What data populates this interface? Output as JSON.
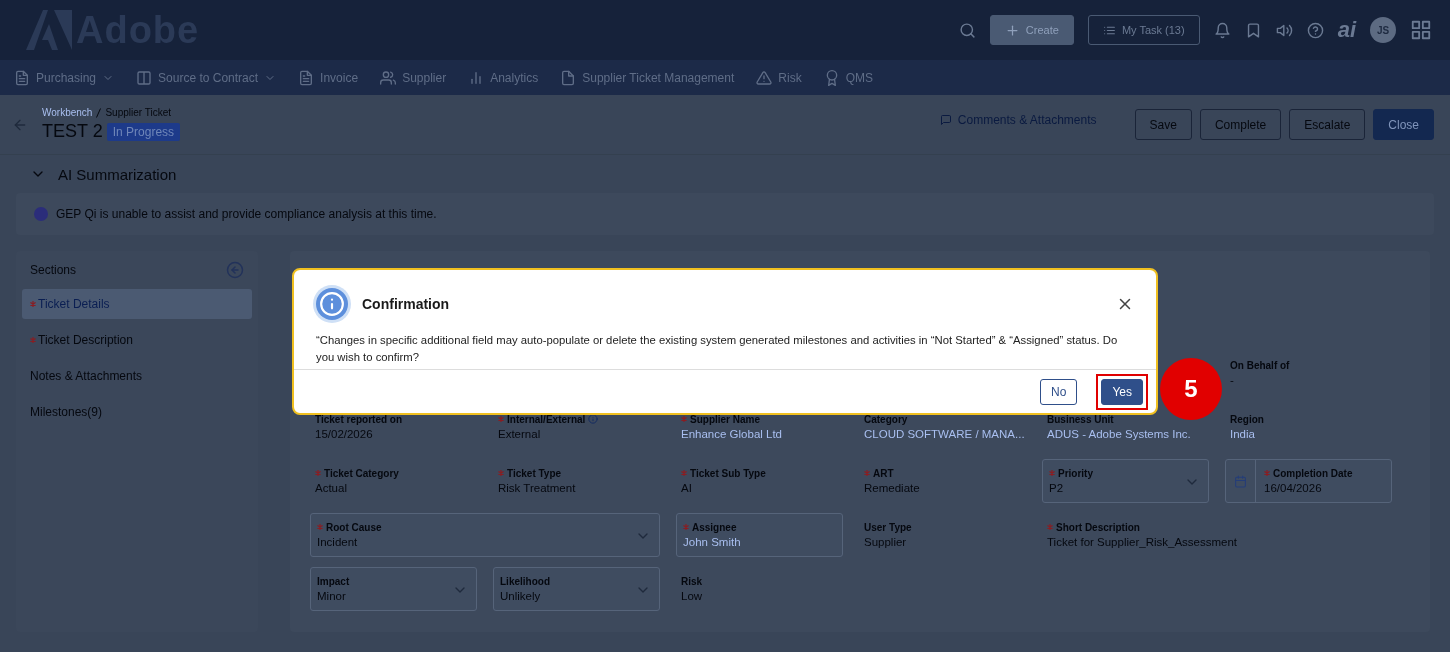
{
  "header": {
    "logo": "Adobe",
    "create_button": "Create",
    "task_button": "My Task (13)",
    "ai_logo": "ai",
    "avatar": "JS"
  },
  "nav": [
    {
      "label": "Purchasing",
      "dropdown": true
    },
    {
      "label": "Source to Contract",
      "dropdown": true
    },
    {
      "label": "Invoice",
      "dropdown": false
    },
    {
      "label": "Supplier",
      "dropdown": false
    },
    {
      "label": "Analytics",
      "dropdown": false
    },
    {
      "label": "Supplier Ticket Management",
      "dropdown": false
    },
    {
      "label": "Risk",
      "dropdown": false
    },
    {
      "label": "QMS",
      "dropdown": false
    }
  ],
  "breadcrumb": [
    "Workbench",
    "Supplier Ticket"
  ],
  "title": "TEST 2",
  "status": "In Progress",
  "comments_link": "Comments & Attachments",
  "actions": [
    {
      "label": "Save",
      "primary": false
    },
    {
      "label": "Complete",
      "primary": false
    },
    {
      "label": "Escalate",
      "primary": false
    },
    {
      "label": "Close",
      "primary": true
    }
  ],
  "ai_section": {
    "title": "AI Summarization",
    "expanded": true,
    "message": "GEP Qi is unable to assist and provide compliance analysis at this time."
  },
  "sections": {
    "title": "Sections",
    "items": [
      {
        "label": "Ticket Details",
        "required": true,
        "selected": true
      },
      {
        "label": "Ticket Description",
        "required": true,
        "selected": false
      },
      {
        "label": "Notes & Attachments",
        "required": false,
        "selected": false
      },
      {
        "label": "Milestones(9)",
        "required": false,
        "selected": false
      }
    ]
  },
  "field_rows": [
    [
      {
        "kind": "text",
        "label": "On Behalf of",
        "value": "-",
        "required": false,
        "link": false
      }
    ],
    [
      {
        "kind": "text",
        "label": "Ticket reported on",
        "value": "15/02/2026",
        "required": false,
        "link": false
      },
      {
        "kind": "text",
        "label": "Internal/External",
        "value": "External",
        "required": true,
        "link": false,
        "info": true
      },
      {
        "kind": "text",
        "label": "Supplier Name",
        "value": "Enhance Global Ltd",
        "required": true,
        "link": true
      },
      {
        "kind": "text",
        "label": "Category",
        "value": "CLOUD SOFTWARE / MANA...",
        "required": false,
        "link": true
      },
      {
        "kind": "text",
        "label": "Business Unit",
        "value": "ADUS - Adobe Systems Inc.",
        "required": false,
        "link": true
      },
      {
        "kind": "text",
        "label": "Region",
        "value": "India",
        "required": false,
        "link": true
      }
    ],
    [
      {
        "kind": "text",
        "label": "Ticket Category",
        "value": "Actual",
        "required": true,
        "link": false
      },
      {
        "kind": "text",
        "label": "Ticket Type",
        "value": "Risk Treatment",
        "required": true,
        "link": false
      },
      {
        "kind": "text",
        "label": "Ticket Sub Type",
        "value": "AI",
        "required": true,
        "link": false
      },
      {
        "kind": "text",
        "label": "ART",
        "value": "Remediate",
        "required": true,
        "link": false
      },
      {
        "kind": "select",
        "label": "Priority",
        "value": "P2",
        "required": true,
        "link": false
      },
      {
        "kind": "date",
        "label": "Completion Date",
        "value": "16/04/2026",
        "required": true,
        "link": false
      }
    ],
    [
      {
        "kind": "select",
        "label": "Root Cause",
        "value": "Incident",
        "required": true,
        "link": false,
        "wide": true
      },
      {
        "kind": "input",
        "label": "Assignee",
        "value": "John Smith",
        "required": true,
        "link": true
      },
      {
        "kind": "text",
        "label": "User Type",
        "value": "Supplier",
        "required": false,
        "link": false
      },
      {
        "kind": "text",
        "label": "Short Description",
        "value": "Ticket for Supplier_Risk_Assessment",
        "required": true,
        "link": false,
        "wide": true
      }
    ],
    [
      {
        "kind": "select",
        "label": "Impact",
        "value": "Minor",
        "required": false,
        "link": false
      },
      {
        "kind": "select",
        "label": "Likelihood",
        "value": "Unlikely",
        "required": false,
        "link": false
      },
      {
        "kind": "text",
        "label": "Risk",
        "value": "Low",
        "required": false,
        "link": false
      }
    ]
  ],
  "dialog": {
    "title": "Confirmation",
    "message": "“Changes in specific additional field may auto-populate or delete the existing system generated milestones and activities in “Not Started” & “Assigned” status. Do you wish to confirm?",
    "buttons": [
      {
        "label": "No",
        "primary": false,
        "highlighted": false
      },
      {
        "label": "Yes",
        "primary": true,
        "highlighted": true
      }
    ]
  },
  "annotation": {
    "step": "5"
  }
}
